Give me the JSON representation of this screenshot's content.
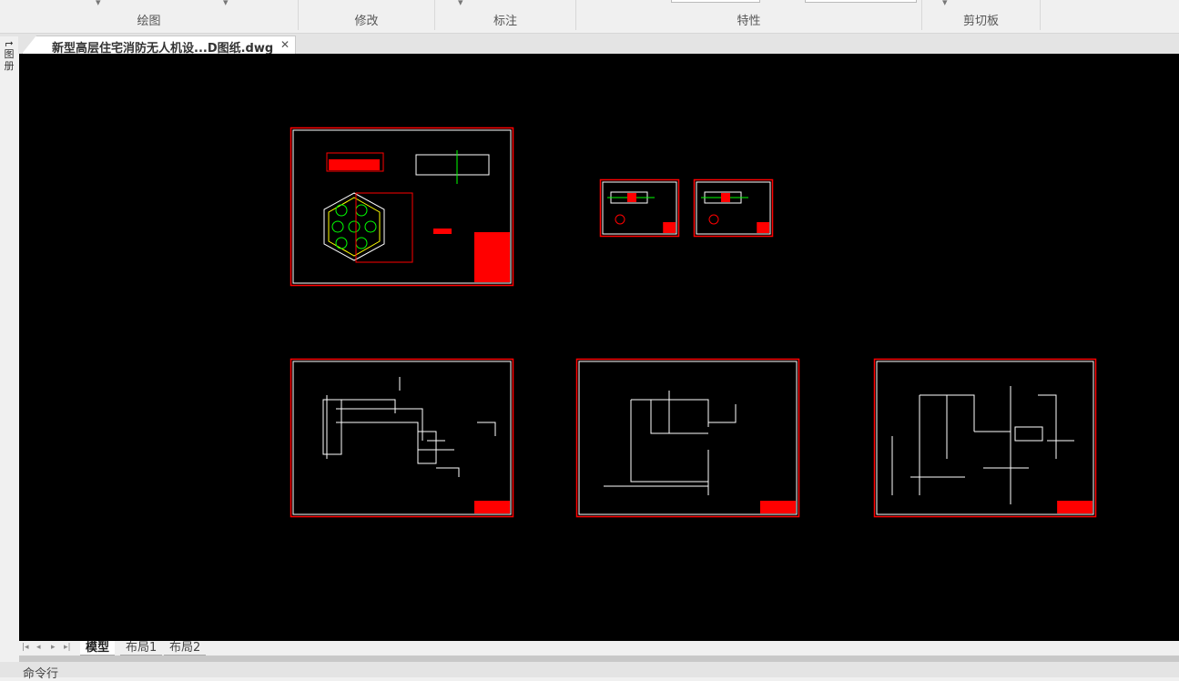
{
  "ribbon": {
    "groups": [
      {
        "label": "绘图"
      },
      {
        "label": "修改"
      },
      {
        "label": "标注"
      },
      {
        "label": "特性"
      },
      {
        "label": "剪切板"
      }
    ]
  },
  "document": {
    "tab_title": "新型高层住宅消防无人机设...D图纸.dwg",
    "close_icon": "close-icon"
  },
  "left_toolbar": {
    "items": [
      "⮣",
      "图",
      "册"
    ]
  },
  "layout_tabs": {
    "items": [
      "模型",
      "布局1",
      "布局2"
    ],
    "active": "模型"
  },
  "command_line": {
    "label": "命令行"
  },
  "colors": {
    "canvas": "#000000",
    "frame": "#ff0000",
    "border": "#ffffff",
    "accent_green": "#00ff00",
    "accent_yellow": "#ffff00"
  }
}
